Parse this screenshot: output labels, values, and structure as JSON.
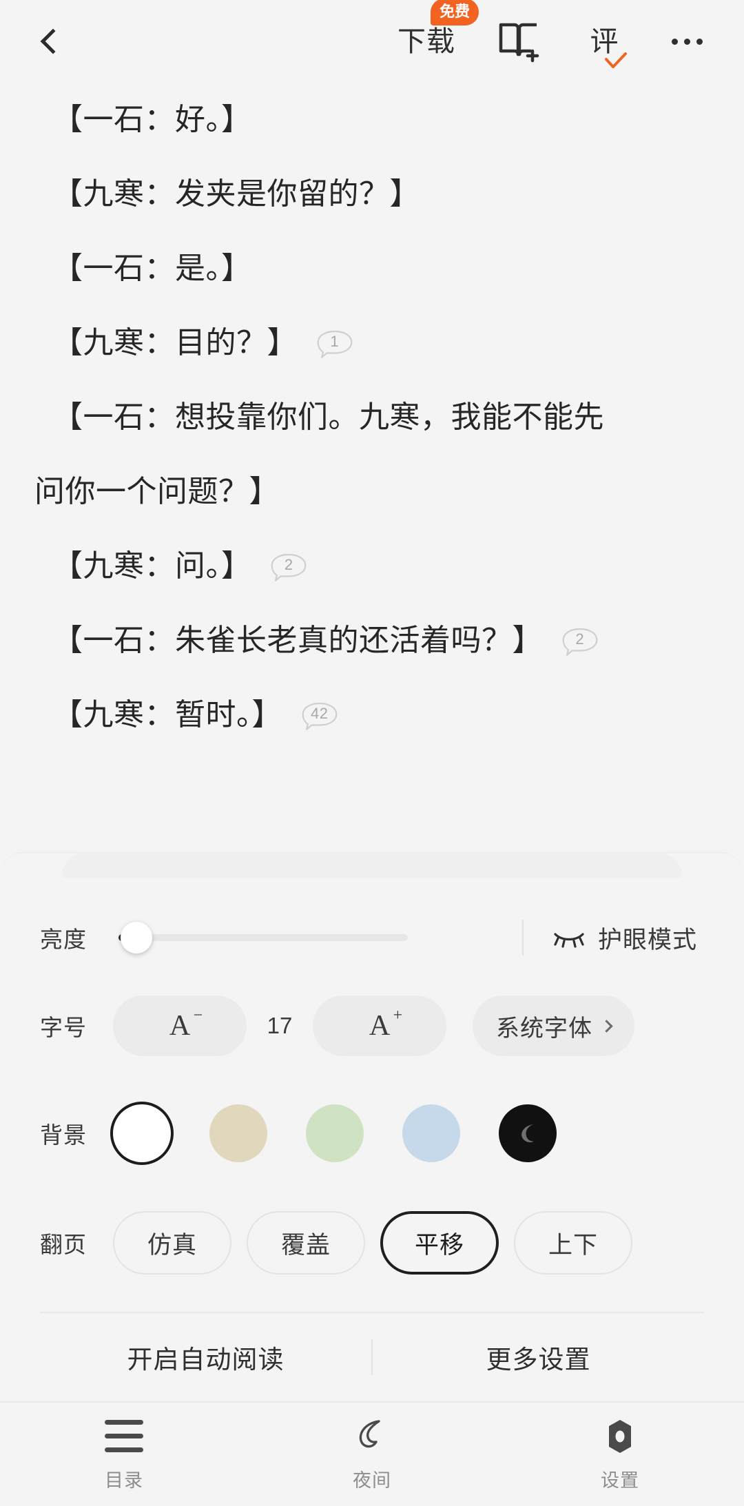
{
  "topbar": {
    "back_icon": "back-chevron-icon",
    "download_label": "下载",
    "free_badge": "免费",
    "bookshelf_icon": "add-to-bookshelf-icon",
    "review_label": "评",
    "review_check_icon": "orange-check-icon",
    "more_icon": "more-dots-icon",
    "accent_color": "#f26322"
  },
  "reader": {
    "paragraphs": [
      {
        "lines": [
          "【一石：好。】"
        ],
        "comment_count": ""
      },
      {
        "lines": [
          "【九寒：发夹是你留的？】"
        ],
        "comment_count": ""
      },
      {
        "lines": [
          "【一石：是。】"
        ],
        "comment_count": ""
      },
      {
        "lines": [
          "【九寒：目的？】"
        ],
        "comment_count": "1"
      },
      {
        "lines": [
          "【一石：想投靠你们。九寒，我能不能先",
          "问你一个问题？】"
        ],
        "comment_count": ""
      },
      {
        "lines": [
          "【九寒：问。】"
        ],
        "comment_count": "2"
      },
      {
        "lines": [
          "【一石：朱雀长老真的还活着吗？】"
        ],
        "comment_count": "2"
      },
      {
        "lines": [
          "【九寒：暂时。】"
        ],
        "comment_count": "42"
      }
    ]
  },
  "settings": {
    "brightness": {
      "label": "亮度",
      "value_percent": 6,
      "eyecare_label": "护眼模式",
      "eyecare_icon": "closed-eye-icon"
    },
    "fontsize": {
      "label": "字号",
      "decrease_label": "A",
      "decrease_sup": "−",
      "value": "17",
      "increase_label": "A",
      "increase_sup": "+",
      "font_picker_label": "系统字体",
      "font_picker_chevron": "chevron-right-icon"
    },
    "background": {
      "label": "背景",
      "swatches": [
        {
          "name": "white",
          "color": "#ffffff",
          "selected": true,
          "night": false
        },
        {
          "name": "beige",
          "color": "#e0d7bd",
          "selected": false,
          "night": false
        },
        {
          "name": "green",
          "color": "#cfe3c2",
          "selected": false,
          "night": false
        },
        {
          "name": "blue",
          "color": "#c6d9ea",
          "selected": false,
          "night": false
        },
        {
          "name": "night",
          "color": "#111111",
          "selected": false,
          "night": true
        }
      ]
    },
    "pageturn": {
      "label": "翻页",
      "options": [
        {
          "label": "仿真",
          "selected": false
        },
        {
          "label": "覆盖",
          "selected": false
        },
        {
          "label": "平移",
          "selected": true
        },
        {
          "label": "上下",
          "selected": false
        }
      ]
    },
    "actions": {
      "auto_read_label": "开启自动阅读",
      "more_settings_label": "更多设置"
    }
  },
  "bottomnav": {
    "items": [
      {
        "label": "目录",
        "icon": "list-menu-icon"
      },
      {
        "label": "夜间",
        "icon": "moon-icon"
      },
      {
        "label": "设置",
        "icon": "gear-icon"
      }
    ]
  }
}
